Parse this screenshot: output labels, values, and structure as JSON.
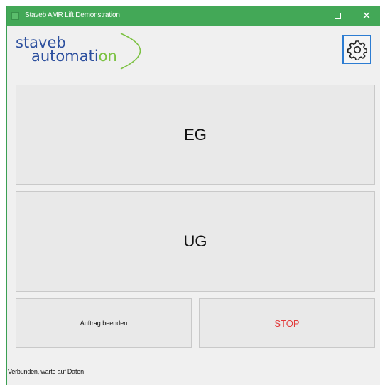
{
  "window": {
    "title": "Staveb AMR Lift Demonstration",
    "controls": {
      "minimize_icon": "minimize-icon",
      "maximize_icon": "maximize-icon",
      "close_icon": "close-icon",
      "close_glyph": "✕"
    },
    "titlebar_color": "#43a857"
  },
  "logo": {
    "line1": "staveb",
    "line2_prefix": "automati",
    "line2_suffix": "on",
    "color_primary": "#2c4f9e",
    "color_accent": "#7cc243"
  },
  "settings": {
    "icon": "gear-icon",
    "border_color": "#2c7cd2"
  },
  "buttons": {
    "eg_label": "EG",
    "ug_label": "UG",
    "auftrag_label": "Auftrag beenden",
    "stop_label": "STOP",
    "stop_color": "#e23b3b"
  },
  "status": {
    "text": "Verbunden, warte auf Daten"
  }
}
